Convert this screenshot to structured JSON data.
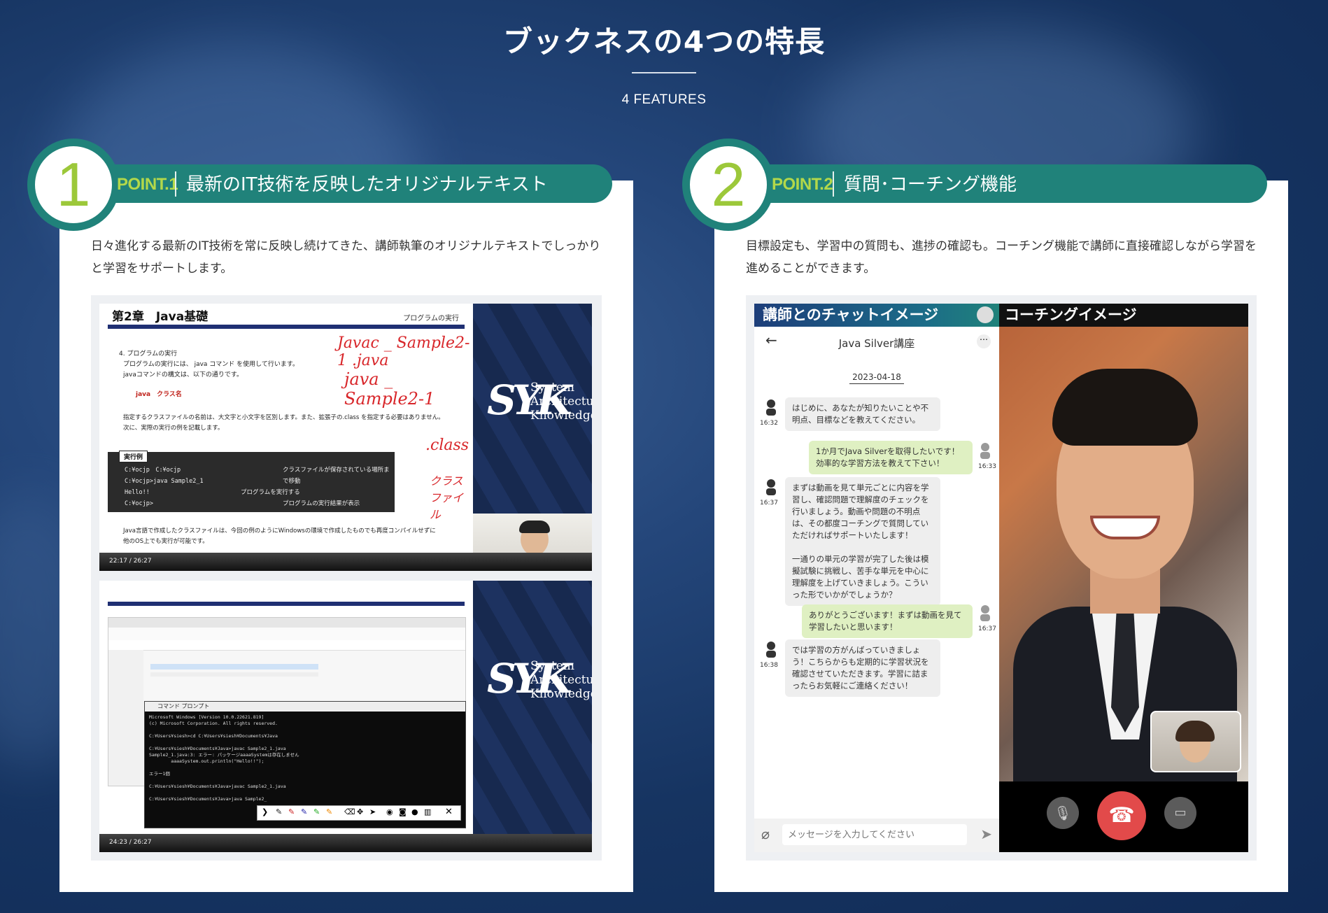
{
  "header": {
    "title": "ブックネスの4つの特長",
    "subtitle": "4 FEATURES"
  },
  "features": [
    {
      "number": "1",
      "point_label": "POINT.1",
      "title": "最新のIT技術を反映したオリジナルテキスト",
      "description": "日々進化する最新のIT技術を常に反映し続けてきた、講師執筆のオリジナルテキストでしっかりと学習をサポートします。",
      "screenshot": {
        "slide1": {
          "chapter": "第2章　Java基礎",
          "corner_label": "プログラムの実行",
          "heading": "4. プログラムの実行",
          "lines": [
            "プログラムの実行には、 java コマンド を使用して行います。",
            "javaコマンドの構文は、以下の通りです。"
          ],
          "syntax": "java　クラス名",
          "body": [
            "指定するクラスファイルの名前は、大文字と小文字を区別します。また、拡張子の.class を指定する必要はありません。",
            "次に、実際の実行の例を記載します。"
          ],
          "example_tag": "実行例",
          "code_lines": [
            "C:¥ocjp　C:¥ocjp",
            "C:¥ocjp>java  Sample2_1",
            "Hello!!",
            "C:¥ocjp>"
          ],
          "code_notes": [
            "クラスファイルが保存されている場所まで移動",
            "プログラムを実行する",
            "プログラムの実行結果が表示"
          ],
          "footer": [
            "Java言語で作成したクラスファイルは、今回の例のようにWindowsの環境で作成したものでも再度コンパイルせずに",
            "他のOS上でも実行が可能です。"
          ],
          "handwriting": [
            "Javac _ Sample2-1 .java",
            "java _ Sample2-1",
            ".class",
            "クラスファイル"
          ],
          "time": "22:17 / 26:27"
        },
        "slide2": {
          "terminal_title": "コマンド プロンプト",
          "terminal_lines": [
            "Microsoft Windows [Version 10.0.22621.819]",
            "(c) Microsoft Corporation. All rights reserved.",
            "",
            "C:¥Users¥siesh>cd C:¥Users¥siesh¥Documents¥Java",
            "",
            "C:¥Users¥siesh¥Documents¥Java>javac Sample2_1.java",
            "Sample2_1.java:3: エラー: パッケージaaaaSystemは存在しません",
            "        aaaaSystem.out.println(\"Hello!!\");",
            "",
            "エラー1個",
            "",
            "C:¥Users¥siesh¥Documents¥Java>javac Sample2_1.java",
            "",
            "C:¥Users¥siesh¥Documents¥Java>java Sample2_"
          ],
          "time": "24:23 / 26:27"
        },
        "logo_lines": [
          "System",
          "Architecture",
          "Knowledge"
        ],
        "logo_mark": "SYK"
      }
    },
    {
      "number": "2",
      "point_label": "POINT.2",
      "title": "質問･コーチング機能",
      "description": "目標設定も、学習中の質問も、進捗の確認も。コーチング機能で講師に直接確認しながら学習を進めることができます。",
      "chat": {
        "header": "講師とのチャットイメージ",
        "room": "Java Silver講座",
        "date": "2023-04-18",
        "messages": [
          {
            "side": "in",
            "time": "16:32",
            "text": "はじめに、あなたが知りたいことや不明点、目標などを教えてください。"
          },
          {
            "side": "out",
            "time": "16:33",
            "text": "1か月でJava Silverを取得したいです！効率的な学習方法を教えて下さい！"
          },
          {
            "side": "in",
            "time": "16:37",
            "text": "まずは動画を見て単元ごとに内容を学習し、確認問題で理解度のチェックを行いましょう。動画や問題の不明点は、その都度コーチングで質問していただければサポートいたします！\n\n一通りの単元の学習が完了した後は模擬試験に挑戦し、苦手な単元を中心に理解度を上げていきましょう。こういった形でいかがでしょうか？"
          },
          {
            "side": "out",
            "time": "16:37",
            "text": "ありがとうございます！まずは動画を見て学習したいと思います！"
          },
          {
            "side": "in",
            "time": "16:38",
            "text": "では学習の方がんばっていきましょう！こちらからも定期的に学習状況を確認させていただきます。学習に詰まったらお気軽にご連絡ください！"
          }
        ],
        "input_placeholder": "メッセージを入力してください"
      },
      "coaching": {
        "header": "コーチングイメージ"
      }
    }
  ],
  "colors": {
    "accent": "#20827a",
    "point_green": "#9cc83a",
    "navy": "#15274e",
    "end_call": "#e24a4a"
  }
}
